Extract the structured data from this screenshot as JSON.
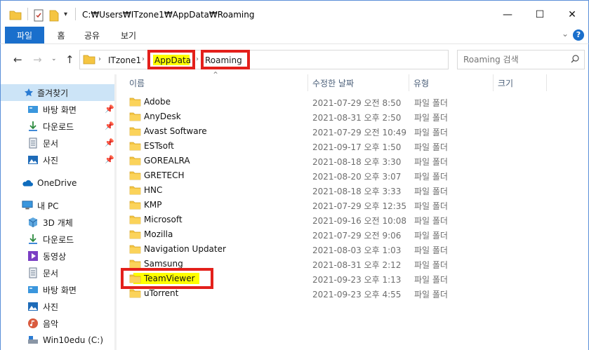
{
  "window": {
    "title": "C:₩Users₩ITzone1₩AppData₩Roaming",
    "minimize_glyph": "—",
    "maximize_glyph": "☐",
    "close_glyph": "✕"
  },
  "ribbon": {
    "tabs": [
      {
        "label": "파일"
      },
      {
        "label": "홈"
      },
      {
        "label": "공유"
      },
      {
        "label": "보기"
      }
    ],
    "help": "?"
  },
  "address": {
    "crumbs": [
      "ITzone1",
      "AppData",
      "Roaming"
    ],
    "refresh_glyph": "↻"
  },
  "search": {
    "placeholder": "Roaming 검색"
  },
  "sidebar": {
    "quick_access": "즐겨찾기",
    "pinned": [
      {
        "label": "바탕 화면",
        "icon": "desktop-icon"
      },
      {
        "label": "다운로드",
        "icon": "download-icon"
      },
      {
        "label": "문서",
        "icon": "document-icon"
      },
      {
        "label": "사진",
        "icon": "picture-icon"
      }
    ],
    "onedrive": "OneDrive",
    "this_pc": "내 PC",
    "pc_items": [
      {
        "label": "3D 개체",
        "icon": "3d-objects-icon"
      },
      {
        "label": "다운로드",
        "icon": "download-icon"
      },
      {
        "label": "동영상",
        "icon": "video-icon"
      },
      {
        "label": "문서",
        "icon": "document-icon"
      },
      {
        "label": "바탕 화면",
        "icon": "desktop-icon"
      },
      {
        "label": "사진",
        "icon": "picture-icon"
      },
      {
        "label": "음악",
        "icon": "music-icon"
      },
      {
        "label": "Win10edu (C:)",
        "icon": "drive-icon"
      }
    ]
  },
  "columns": {
    "name": "이름",
    "date": "수정한 날짜",
    "type": "유형",
    "size": "크기"
  },
  "files": [
    {
      "name": "Adobe",
      "date": "2021-07-29 오전 8:50",
      "type": "파일 폴더"
    },
    {
      "name": "AnyDesk",
      "date": "2021-08-31 오후 2:50",
      "type": "파일 폴더"
    },
    {
      "name": "Avast Software",
      "date": "2021-07-29 오전 10:49",
      "type": "파일 폴더"
    },
    {
      "name": "ESTsoft",
      "date": "2021-09-17 오후 1:50",
      "type": "파일 폴더"
    },
    {
      "name": "GOREALRA",
      "date": "2021-08-18 오후 3:30",
      "type": "파일 폴더"
    },
    {
      "name": "GRETECH",
      "date": "2021-08-20 오후 3:07",
      "type": "파일 폴더"
    },
    {
      "name": "HNC",
      "date": "2021-08-18 오후 3:33",
      "type": "파일 폴더"
    },
    {
      "name": "KMP",
      "date": "2021-07-29 오후 12:35",
      "type": "파일 폴더"
    },
    {
      "name": "Microsoft",
      "date": "2021-09-16 오전 10:08",
      "type": "파일 폴더"
    },
    {
      "name": "Mozilla",
      "date": "2021-07-29 오전 9:06",
      "type": "파일 폴더"
    },
    {
      "name": "Navigation Updater",
      "date": "2021-08-03 오후 1:03",
      "type": "파일 폴더"
    },
    {
      "name": "Samsung",
      "date": "2021-08-31 오후 2:12",
      "type": "파일 폴더"
    },
    {
      "name": "TeamViewer",
      "date": "2021-09-23 오후 1:13",
      "type": "파일 폴더"
    },
    {
      "name": "uTorrent",
      "date": "2021-09-23 오후 4:55",
      "type": "파일 폴더"
    }
  ],
  "colors": {
    "accent": "#1a6fcc",
    "highlight_border": "#e3201b",
    "highlight_fill": "#ffff00",
    "folder": "#f5c542",
    "selected": "#cce4f7"
  }
}
